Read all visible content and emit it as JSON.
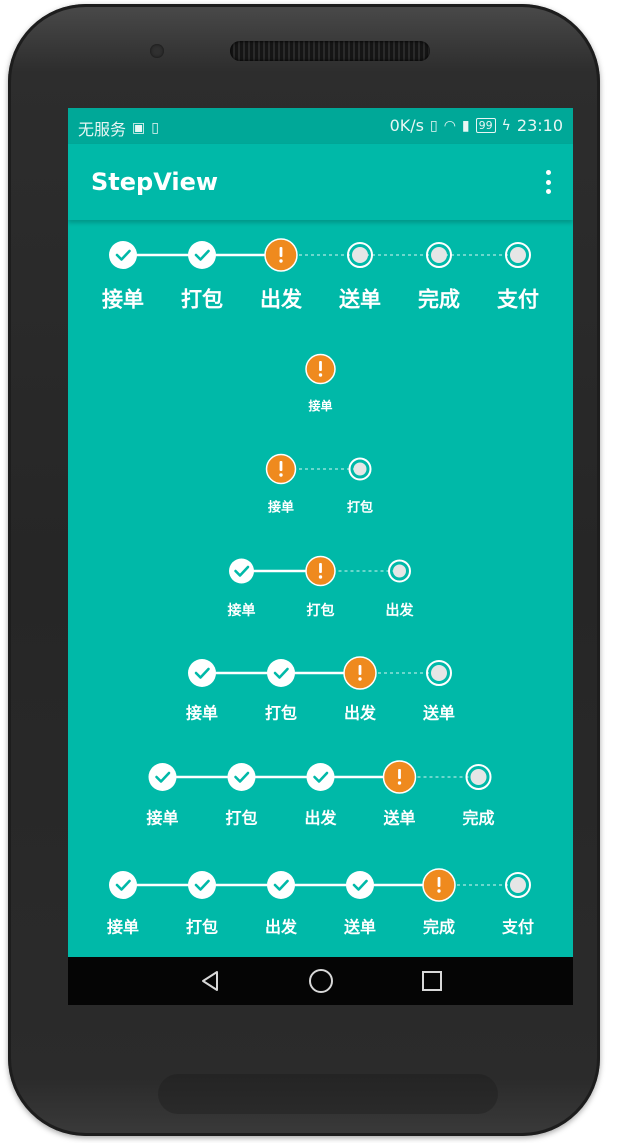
{
  "status_bar": {
    "carrier": "无服务",
    "speed": "0K/s",
    "battery": "99",
    "time": "23:10"
  },
  "app_bar": {
    "title": "StepView",
    "menu_icon": "more-vert-icon"
  },
  "steps": [
    "接单",
    "打包",
    "出发",
    "送单",
    "完成",
    "支付"
  ],
  "step_views": [
    {
      "count": 6,
      "current": 2
    },
    {
      "count": 1,
      "current": 0
    },
    {
      "count": 2,
      "current": 0
    },
    {
      "count": 3,
      "current": 1
    },
    {
      "count": 4,
      "current": 2
    },
    {
      "count": 5,
      "current": 3
    },
    {
      "count": 6,
      "current": 4
    }
  ],
  "colors": {
    "background": "#00b9a8",
    "status_bar": "#00a898",
    "attention": "#ef8a1e",
    "line": "#ffffff"
  },
  "nav_bar": {
    "icons": [
      "back-triangle-icon",
      "home-circle-icon",
      "recents-square-icon"
    ]
  }
}
